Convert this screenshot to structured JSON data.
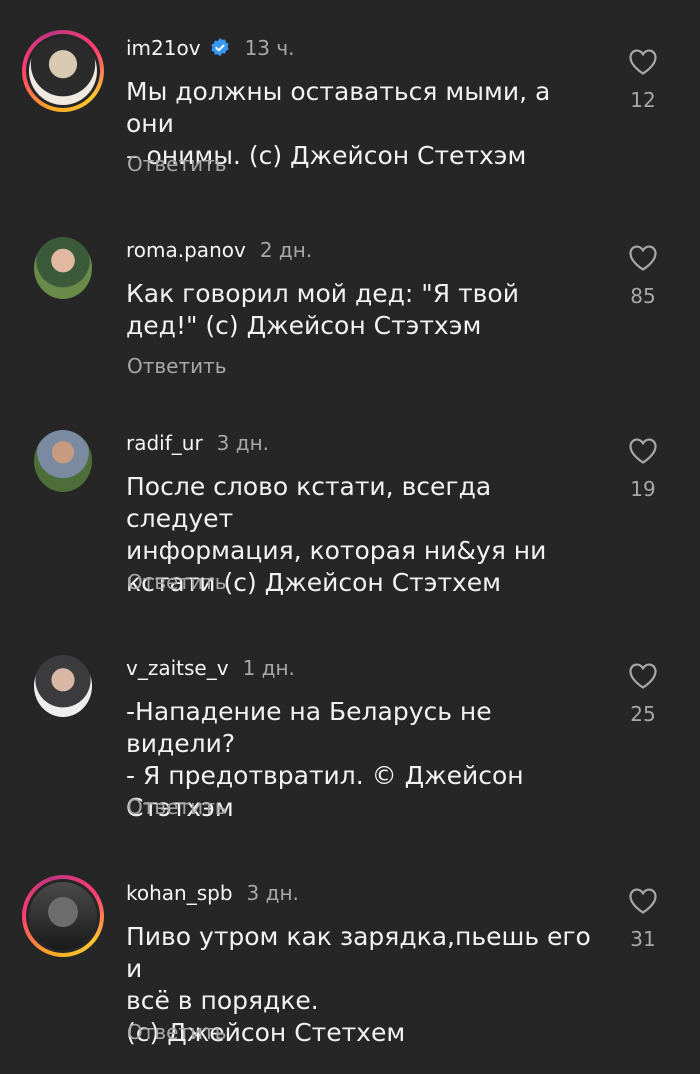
{
  "comments": [
    {
      "username": "im21ov",
      "verified": true,
      "time": "13 ч.",
      "text": "Мы должны оставаться мыми, а они\n– онимы. (с) Джейсон Стетхэм",
      "reply_label": "Ответить",
      "likes": "12",
      "avatar_icon": "user-avatar-photo"
    },
    {
      "username": "roma.panov",
      "verified": false,
      "time": "2 дн.",
      "text": "Как говорил мой дед: \"Я твой\nдед!\" (с) Джейсон Стэтхэм",
      "reply_label": "Ответить",
      "likes": "85",
      "avatar_icon": "user-avatar-photo"
    },
    {
      "username": "radif_ur",
      "verified": false,
      "time": "3 дн.",
      "text": "После слово кстати, всегда следует\nинформация, которая ни&уя ни\nкстати (с) Джейсон Стэтхем",
      "reply_label": "Ответить",
      "likes": "19",
      "avatar_icon": "user-avatar-photo"
    },
    {
      "username": "v_zaitse_v",
      "verified": false,
      "time": "1 дн.",
      "text": "-Нападение на Беларусь не видели?\n- Я предотвратил. © Джейсон\nСтэтхэм",
      "reply_label": "Ответить",
      "likes": "25",
      "avatar_icon": "user-avatar-photo"
    },
    {
      "username": "kohan_spb",
      "verified": false,
      "time": "3 дн.",
      "text": "Пиво утром как зарядка,пьешь его и\nвсё в порядке.\n(с) Джейсон Стетхем",
      "reply_label": "Ответить",
      "likes": "31",
      "avatar_icon": "user-avatar-photo"
    }
  ],
  "colors": {
    "background": "#262626",
    "primary_text": "#f2f2f2",
    "secondary_text": "#a8a8a8",
    "verified_blue": "#3897f0"
  }
}
